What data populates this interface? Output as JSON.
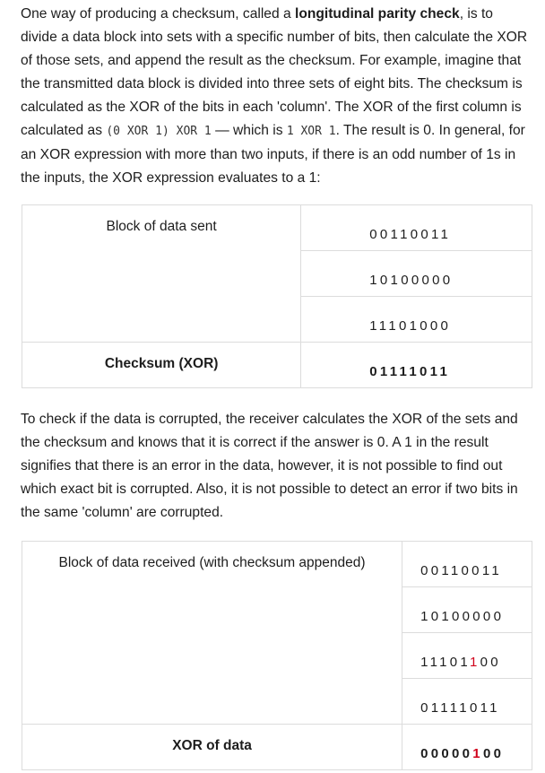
{
  "para1": {
    "t1": "One way of producing a checksum, called a ",
    "term": "longitudinal parity check",
    "t2": ", is to divide a data block into sets with a specific number of bits, then calculate the XOR of those sets, and append the result as the checksum. For example, imagine that the transmitted data block is divided into three sets of eight bits. The checksum is calculated as the XOR of the bits in each 'column'. The XOR of the first column is calculated as ",
    "code1": "(0 XOR 1) XOR 1",
    "t3": " — which is ",
    "code2": "1 XOR 1",
    "t4": ". The result is 0. In general, for an XOR expression with more than two inputs, if there is an odd number of 1s in the inputs, the XOR expression evaluates to a 1:"
  },
  "table_sent": {
    "label": "Block of data sent",
    "rows": [
      "00110011",
      "10100000",
      "11101000"
    ],
    "checksum_label": "Checksum (XOR)",
    "checksum": "01111011"
  },
  "para2": "To check if the data is corrupted, the receiver calculates the XOR of the sets and the checksum and knows that it is correct if the answer is 0. A 1 in the result signifies that there is an error in the data, however, it is not possible to find out which exact bit is corrupted. Also, it is not possible to detect an error if two bits in the same 'column' are corrupted.",
  "table_received": {
    "label": "Block of data received (with checksum appended)",
    "row1": "00110011",
    "row2": "10100000",
    "row3": {
      "a": "11101",
      "err": "1",
      "b": "00"
    },
    "row4": "01111011",
    "xor_label": "XOR of data",
    "xor": {
      "a": "00000",
      "err": "1",
      "b": "00"
    }
  },
  "colors": {
    "text": "#1d1d1d",
    "border": "#dcdcdc",
    "error": "#d0021b"
  }
}
